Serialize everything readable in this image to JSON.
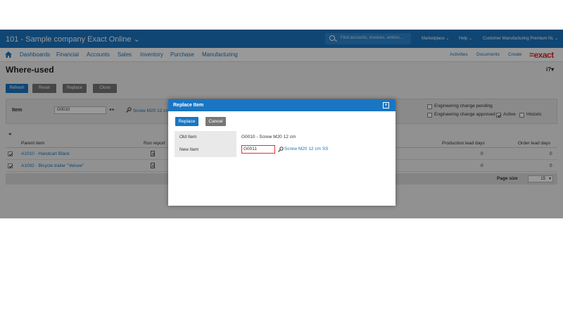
{
  "topbar": {
    "title": "101 - Sample company Exact Online",
    "title_chevron": "⌄",
    "search_placeholder": "Find accounts, invoices, entries...",
    "links": [
      "Marketplace ⌄",
      "Help ⌄",
      "Customer Manufacturing Premium NL ⌄"
    ]
  },
  "nav": {
    "items": [
      "Dashboards",
      "Financial",
      "Accounts",
      "Sales",
      "Inventory",
      "Purchase",
      "Manufacturing"
    ],
    "right_items": [
      "Activities",
      "Documents",
      "Create"
    ],
    "logo": "=exact"
  },
  "page": {
    "title": "Where-used",
    "help": "i?▾"
  },
  "toolbar": {
    "buttons": [
      "Refresh",
      "Reset",
      "Replace",
      "Close"
    ]
  },
  "filter": {
    "item_label": "Item",
    "item_value": "G0010",
    "nav_arrows": "◂ ▸",
    "item_link": "Screw M20 12 cm",
    "checkboxes": [
      {
        "label": "Engineering change pending",
        "checked": false
      },
      {
        "label": "Engineering change approved",
        "checked": false
      },
      {
        "label": "Active",
        "checked": true
      },
      {
        "label": "Historic",
        "checked": false
      }
    ]
  },
  "grid": {
    "collapse": "◂",
    "headers": [
      "Parent item",
      "Run report",
      "Production lead days",
      "Order lead days"
    ],
    "rows": [
      {
        "checked": true,
        "parent": "A1010 - Handcart Black",
        "production": "0",
        "order": "0"
      },
      {
        "checked": true,
        "parent": "A1002 - Bicycle trailer \"Veloxe\"",
        "production": "0",
        "order": "0"
      }
    ],
    "page_size_label": "Page size",
    "page_size_value": "15"
  },
  "dialog": {
    "title": "Replace Item",
    "close": "×",
    "replace_label": "Replace",
    "cancel_label": "Cancel",
    "old_item_label": "Old Item",
    "old_item_value": "G0010 - Screw M20 12 cm",
    "new_item_label": "New Item",
    "new_item_value": "G0011",
    "new_item_link": "Screw M20 12 cm SS"
  },
  "colors": {
    "primary": "#1a76c2",
    "brand": "#e0282e",
    "invalid_border": "#dd3333"
  }
}
